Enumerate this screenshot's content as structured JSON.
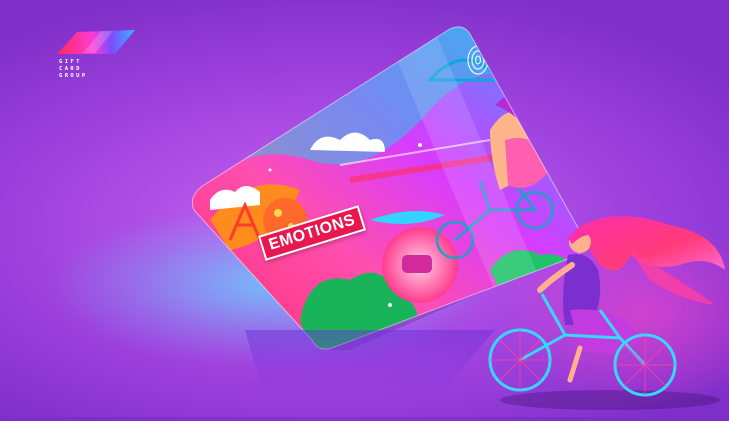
{
  "logo": {
    "text_lines": [
      "GIFT",
      "CARD",
      "GROUP"
    ],
    "colors": [
      "#ff2a5c",
      "#ff3bd2",
      "#7b4bff",
      "#38b6ff"
    ]
  },
  "card": {
    "label": "EMOTIONS",
    "label_bg": "#e8174f"
  },
  "scene": {
    "background": "#b04fe6",
    "accent_cyan": "#5edcff",
    "accent_pink": "#ff46c8"
  }
}
